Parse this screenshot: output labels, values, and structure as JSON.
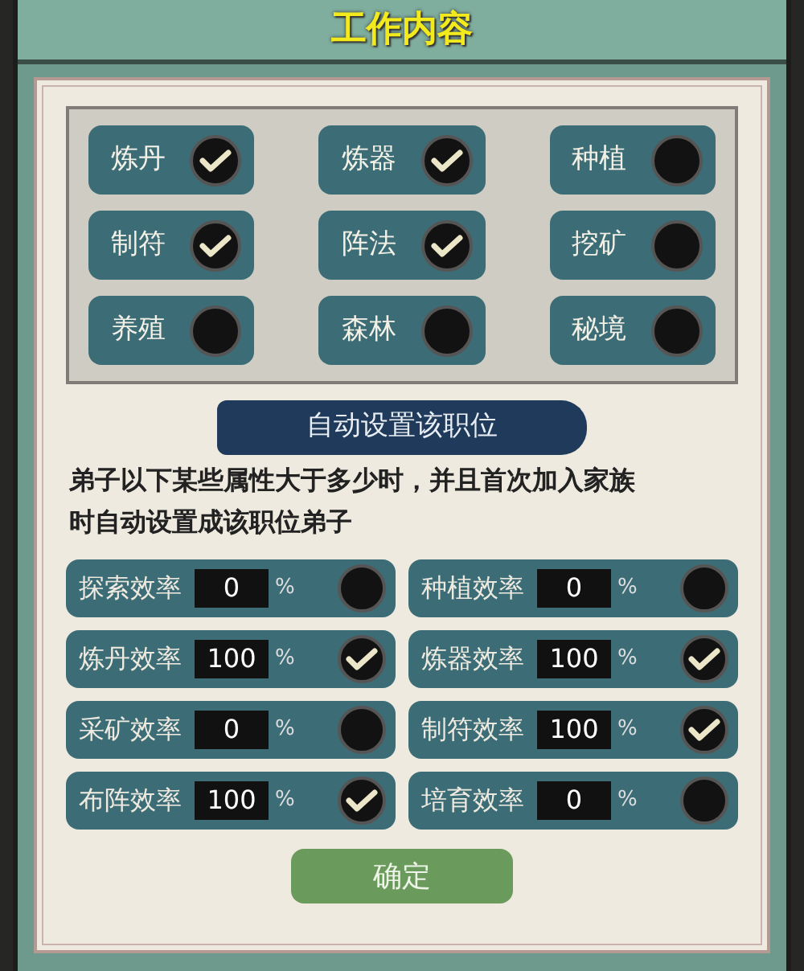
{
  "window": {
    "title": "工作内容"
  },
  "jobs": [
    {
      "label": "炼丹",
      "checked": true
    },
    {
      "label": "炼器",
      "checked": true
    },
    {
      "label": "种植",
      "checked": false
    },
    {
      "label": "制符",
      "checked": true
    },
    {
      "label": "阵法",
      "checked": true
    },
    {
      "label": "挖矿",
      "checked": false
    },
    {
      "label": "养殖",
      "checked": false
    },
    {
      "label": "森林",
      "checked": false
    },
    {
      "label": "秘境",
      "checked": false
    }
  ],
  "auto_section": {
    "title": "自动设置该职位",
    "description": "弟子以下某些属性大于多少时，并且首次加入家族时自动设置成该职位弟子"
  },
  "attributes": [
    {
      "label": "探索效率",
      "value": "0",
      "unit": "%",
      "checked": false
    },
    {
      "label": "种植效率",
      "value": "0",
      "unit": "%",
      "checked": false
    },
    {
      "label": "炼丹效率",
      "value": "100",
      "unit": "%",
      "checked": true
    },
    {
      "label": "炼器效率",
      "value": "100",
      "unit": "%",
      "checked": true
    },
    {
      "label": "采矿效率",
      "value": "0",
      "unit": "%",
      "checked": false
    },
    {
      "label": "制符效率",
      "value": "100",
      "unit": "%",
      "checked": true
    },
    {
      "label": "布阵效率",
      "value": "100",
      "unit": "%",
      "checked": true
    },
    {
      "label": "培育效率",
      "value": "0",
      "unit": "%",
      "checked": false
    }
  ],
  "confirm_button": "确定"
}
